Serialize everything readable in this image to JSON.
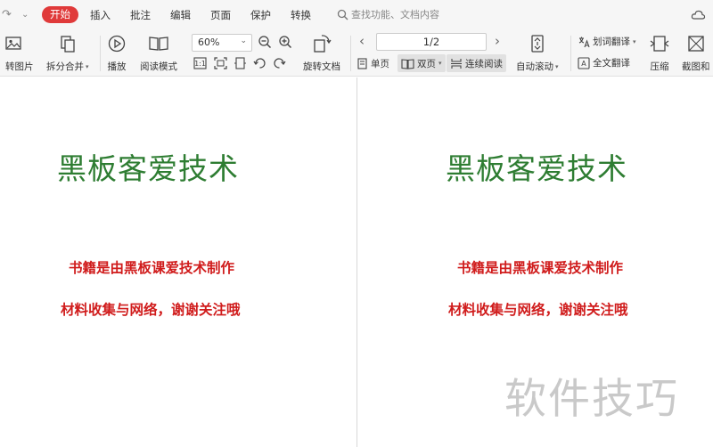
{
  "menubar": {
    "tabs": [
      {
        "label": "开始",
        "active": true
      },
      {
        "label": "插入"
      },
      {
        "label": "批注"
      },
      {
        "label": "编辑"
      },
      {
        "label": "页面"
      },
      {
        "label": "保护"
      },
      {
        "label": "转换"
      }
    ],
    "search_placeholder": "查找功能、文档内容",
    "accent_color": "#e03a3a"
  },
  "toolbar": {
    "pdf_to_image": "转图片",
    "split_merge": "拆分合并",
    "play": "播放",
    "read_mode": "阅读模式",
    "zoom": "60%",
    "rotate_doc": "旋转文档",
    "page_indicator": "1/2",
    "single_page": "单页",
    "double_page": "双页",
    "continuous": "连续阅读",
    "auto_scroll": "自动滚动",
    "word_translate": "划词翻译",
    "full_translate": "全文翻译",
    "compress": "压缩",
    "screenshot": "截图和"
  },
  "document": {
    "pages": [
      {
        "logo": "黑板客爱技术",
        "line1": "书籍是由黑板课爱技术制作",
        "line2": "材料收集与网络，谢谢关注哦"
      },
      {
        "logo": "黑板客爱技术",
        "line1": "书籍是由黑板课爱技术制作",
        "line2": "材料收集与网络，谢谢关注哦"
      }
    ],
    "text_color": "#d01c1c",
    "logo_color": "#2e7d32",
    "watermark": "软件技巧"
  }
}
